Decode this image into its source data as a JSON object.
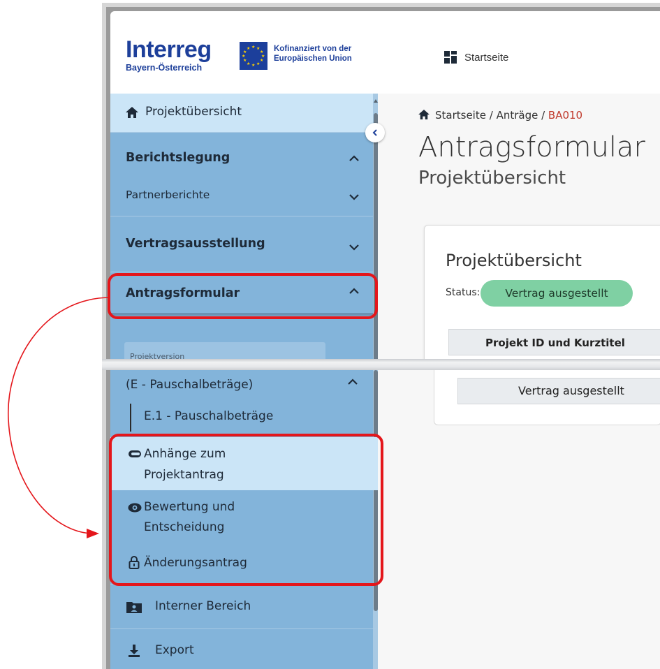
{
  "header": {
    "logo_main": "Interreg",
    "logo_sub": "Bayern-Österreich",
    "eu_line1": "Kofinanziert von der",
    "eu_line2": "Europäischen Union",
    "start_label": "Startseite"
  },
  "sidebar": {
    "project_overview": "Projektübersicht",
    "reporting": "Berichtslegung",
    "partner_reports": "Partnerberichte",
    "contract_issue": "Vertragsausstellung",
    "application_form": "Antragsformular",
    "project_version": "Projektversion",
    "lump_sums": "(E - Pauschalbeträge)",
    "lump_sums_sub": "E.1 - Pauschalbeträge",
    "attachments_l1": "Anhänge zum",
    "attachments_l2": "Projektantrag",
    "assessment_l1": "Bewertung und",
    "assessment_l2": "Entscheidung",
    "modification": "Änderungsantrag",
    "internal": "Interner Bereich",
    "export": "Export"
  },
  "main": {
    "breadcrumb_home": "Startseite",
    "breadcrumb_sep1": " / ",
    "breadcrumb_applications": "Anträge",
    "breadcrumb_sep2": " / ",
    "breadcrumb_current": "BA010",
    "title": "Antragsformular",
    "subtitle": "Projektübersicht",
    "card_title": "Projektübersicht",
    "status_label": "Status:",
    "status_value": "Vertrag ausgestellt",
    "table_header": "Projekt ID und Kurztitel",
    "table_cell": "Vertrag ausgestellt"
  },
  "colors": {
    "sidebar": "#83b4da",
    "sidebar_active": "#cbe5f7",
    "status_badge": "#7fd0a3",
    "highlight": "#e4161b",
    "brand_blue": "#1d3f9a"
  }
}
